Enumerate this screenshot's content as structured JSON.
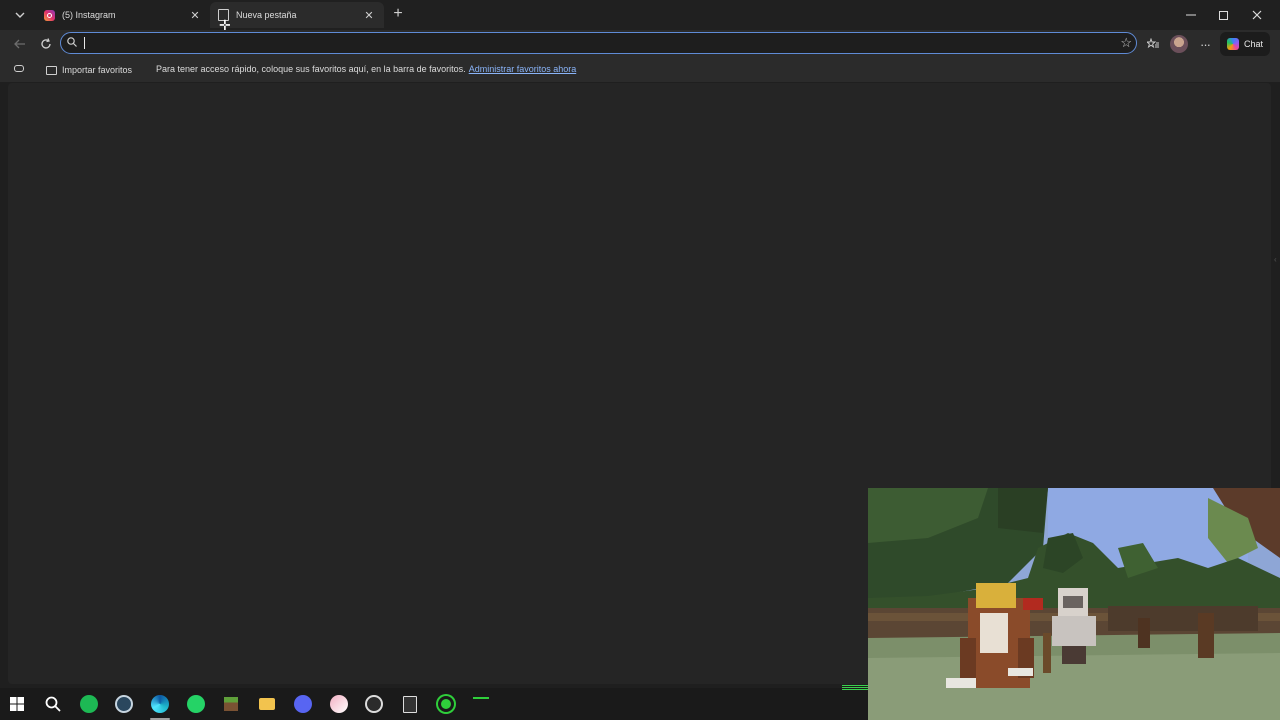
{
  "tabs": [
    {
      "label": "(5) Instagram",
      "favicon": "instagram-icon",
      "active": false
    },
    {
      "label": "Nueva pestaña",
      "favicon": "page-icon",
      "active": true
    }
  ],
  "toolbar": {
    "address_value": "",
    "chat_label": "Chat"
  },
  "favorites_bar": {
    "import_label": "Importar favoritos",
    "message": "Para tener acceso rápido, coloque sus favoritos aquí, en la barra de favoritos.",
    "manage_link": "Administrar favoritos ahora"
  },
  "taskbar": {
    "items": [
      "windows-start-icon",
      "search-icon",
      "spotify-icon",
      "steam-icon",
      "edge-icon",
      "whatsapp-icon",
      "minecraft-icon",
      "file-explorer-icon",
      "discord-icon",
      "app-icon",
      "obs-icon",
      "epic-games-icon",
      "green-app-icon",
      "terminal-icon"
    ]
  },
  "colors": {
    "accent": "#5f8bd6",
    "link": "#8ab4f8",
    "background": "#1f1f1f"
  }
}
